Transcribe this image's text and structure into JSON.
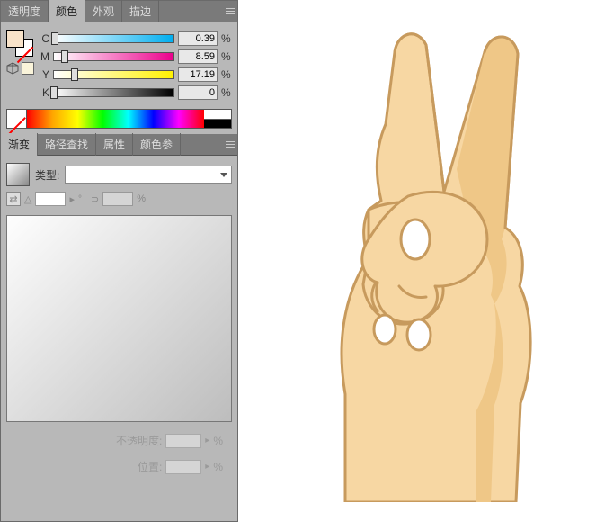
{
  "tabs_color": {
    "opacity": "透明度",
    "color": "颜色",
    "appearance": "外观",
    "stroke": "描边"
  },
  "color": {
    "c_label": "C",
    "c_value": "0.39",
    "c_pct": "%",
    "m_label": "M",
    "m_value": "8.59",
    "m_pct": "%",
    "y_label": "Y",
    "y_value": "17.19",
    "y_pct": "%",
    "k_label": "K",
    "k_value": "0",
    "k_pct": "%",
    "fill_hex": "#f8e3c9"
  },
  "tabs_grad": {
    "gradient": "渐变",
    "pathfinder": "路径查找",
    "attributes": "属性",
    "color_ref": "颜色参"
  },
  "gradient": {
    "type_label": "类型:",
    "type_value": "",
    "angle_value": "",
    "opacity_label": "不透明度:",
    "opacity_unit": "%",
    "location_label": "位置:",
    "location_unit": "%"
  },
  "canvas": {
    "subject": "victory-hand-illustration",
    "skin": "#f7d7a3",
    "skin_shadow": "#e8bd82",
    "nail": "#fff"
  }
}
